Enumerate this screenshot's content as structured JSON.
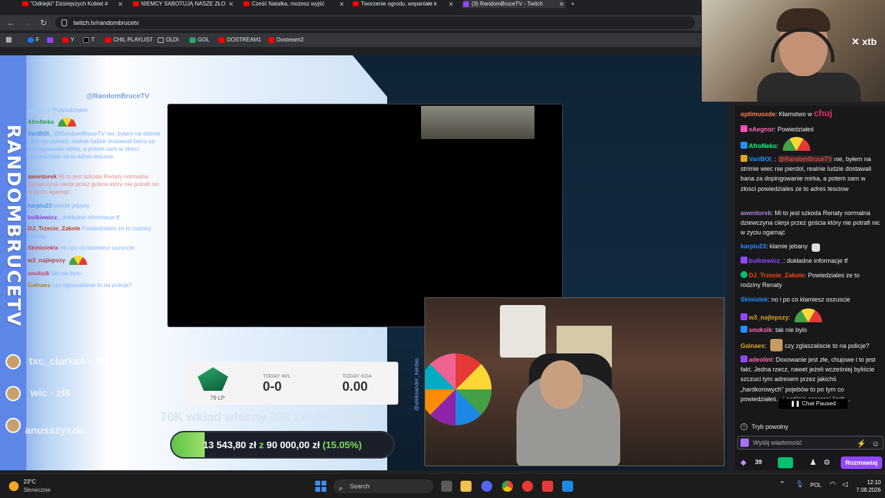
{
  "browser": {
    "tabs": [
      {
        "label": "\"Odklejki\" Dzisiejszych Kobiet #",
        "icon": "youtube-icon"
      },
      {
        "label": "NIEMCY SABOTUJĄ NASZE ZŁO",
        "icon": "youtube-icon"
      },
      {
        "label": "Cześć Natalka, możesz wyjść",
        "icon": "youtube-icon"
      },
      {
        "label": "Tworzenie ogrodu, wspaniałe k",
        "icon": "youtube-icon"
      },
      {
        "label": "(3) RandomBruceTV - Twitch",
        "icon": "twitch-icon"
      }
    ],
    "close_glyph": "✕",
    "new_tab_glyph": "+",
    "url": "twitch.tv/randombrucetv",
    "bookmarks": [
      {
        "label": "F",
        "color": "#1877f2"
      },
      {
        "label": "",
        "color": "#9147ff"
      },
      {
        "label": "Y",
        "color": "#ff0000"
      },
      {
        "label": "T",
        "color": "#000000"
      },
      {
        "label": "CHIL PLAYLIST",
        "color": "#ff0000"
      },
      {
        "label": "OLD\\",
        "color": "#5f6368"
      },
      {
        "label": "GOL",
        "color": "#2aa86a"
      },
      {
        "label": "DOSTREAM1",
        "color": "#ff0000"
      },
      {
        "label": "Dostream2",
        "color": "#ff0000"
      }
    ]
  },
  "overlay": {
    "channel_handle": "@RandomBruceTV",
    "vertical_logo": "RANDOMBRUCETV",
    "chat": [
      {
        "user": "xAegnor",
        "text": "Powiedziałeś"
      },
      {
        "user": "AfroNeko",
        "text": ""
      },
      {
        "user": "VariBOI_",
        "text": "@RandomBruceTV nie, byłem na strimie wiec nie pierdol, realnie ludzie dostawali bana za dopingowanie mirka, a potem sam w złosci powiedziales ze to adres tesciow"
      },
      {
        "user": "awentorek",
        "text": "Mi to jest szkoda Renaty normalna dziewczyna cierpi przez gościa który nie potrafi nic w zyciu ogarnąć"
      },
      {
        "user": "karpiu23",
        "text": "klamie jebany"
      },
      {
        "user": "bulkiewicz_",
        "text": "dokładne informacje tf"
      },
      {
        "user": "DJ_Trzecie_Zakole",
        "text": "Powiedziales ze to rodziny Renaty"
      },
      {
        "user": "Skiniolek\\s",
        "text": "no i po co klamiesz oszuscie"
      },
      {
        "user": "w3_najlepszy",
        "text": ""
      },
      {
        "user": "snuksik",
        "text": "tak nie bylo"
      },
      {
        "user": "Galnaes",
        "text": "czy zglaszaliscie to na policje?"
      }
    ],
    "players": [
      {
        "name": "txc_clarkae - zł56"
      },
      {
        "name": "wic - zł8"
      },
      {
        "name": "anusszyszki"
      }
    ],
    "rank": {
      "lp": "79 LP",
      "wl_header": "TODAY W/L",
      "wl_value": "0-0",
      "kda_header": "TODAY KDA",
      "kda_value": "0.00"
    },
    "sponsor_vertical": "@aleksander_kardas",
    "goal": {
      "title": "70K wkład własny 20k Lekarze/Leki",
      "current": "13 543,80 zł",
      "separator": "z",
      "target": "90 000,00 zł",
      "percent_label": "(15.05%)",
      "progress": 0.1505
    }
  },
  "webcam_brand": "xtb",
  "chat": {
    "messages": [
      {
        "user": "optimusxde",
        "color": "#ff7f50",
        "text": "Kłamstwo w",
        "extra": "chuj"
      },
      {
        "user": "xAegnor",
        "color": "#ff69b4",
        "text": "Powiedziałeś",
        "badge": "#ff4fb5"
      },
      {
        "user": "AfroNeko",
        "color": "#00ff7f",
        "text": "",
        "badge": "#1e90ff",
        "gauge": true
      },
      {
        "user": "VariBOI_",
        "color": "#1e90ff",
        "mention": "@RandomBruceTV",
        "text": "nie, byłem na strimie wiec nie pierdol, realnie ludzie dostawali bana za dopingowanie mirka, a potem sam w złosci powiedziales ze to adres tesciow"
      },
      {
        "user": "awentorek",
        "color": "#b57edc",
        "text": "Mi to jest szkoda Renaty normalna dziewczyna cierpi przez gościa który nie potrafi nic w zyciu ogarnąć"
      },
      {
        "user": "karpiu23",
        "color": "#1e90ff",
        "text": "klamie jebany"
      },
      {
        "user": "bulkiewicz_",
        "color": "#9147ff",
        "text": "dokładne informacje tf",
        "badge": "#9147ff"
      },
      {
        "user": "DJ_Trzecie_Zakole",
        "color": "#ff4500",
        "text": "Powiedziales ze to rodziny Renaty",
        "badge": "#00c16f"
      },
      {
        "user": "Skiniolek",
        "color": "#1e90ff",
        "text": "no i po co klamiesz oszuscie"
      },
      {
        "user": "w3_najlepszy",
        "color": "#daa520",
        "text": "",
        "badge": "#9147ff",
        "gauge": true
      },
      {
        "user": "snuksik",
        "color": "#ff69b4",
        "text": "tak nie bylo",
        "badge": "#1e90ff"
      },
      {
        "user": "Galnaes",
        "color": "#daa520",
        "text": "czy zglaszaliscie to na policje?"
      },
      {
        "user": "adeolini",
        "color": "#ff69b4",
        "text": "Doxowanie jest złe, chujowe i to jest fakt. Jedna rzecz, nawet jeżeli wcześniej byliście szczuci tym adresem przez jakichś „hardkorowych\" pojebów to po tym co powiedziałeś... i ogólnie szerszej liczb...",
        "badge": "#9147ff"
      }
    ],
    "paused_label": "Chat Paused",
    "mode_label": "Tryb powolny",
    "input_placeholder": "Wyślij wiadomość",
    "points": "39",
    "send_label": "Rozmawiaj"
  },
  "taskbar": {
    "temperature": "23°C",
    "condition": "Słonecznie",
    "search_placeholder": "Search",
    "language": "POL",
    "time": "12:10",
    "date": "7.08.2026"
  }
}
